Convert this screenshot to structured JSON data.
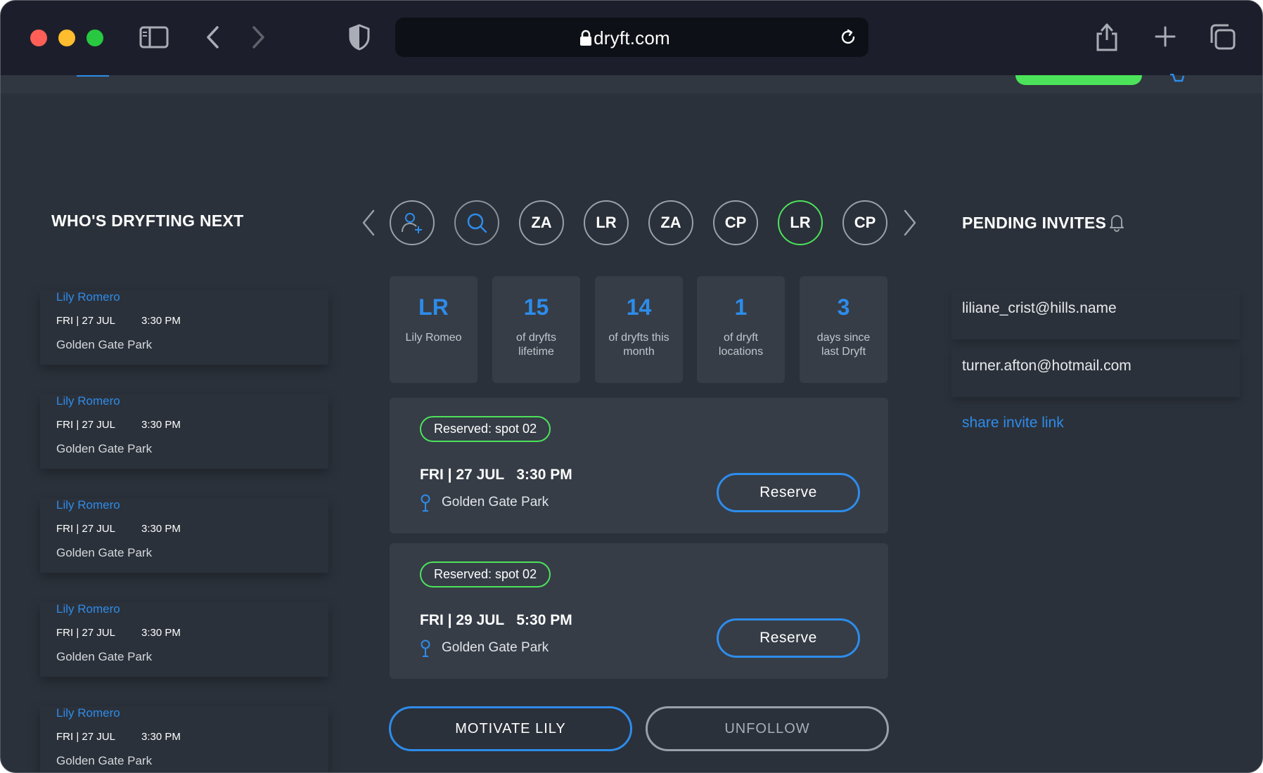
{
  "browser": {
    "url": "dryft.com"
  },
  "colors": {
    "accent_blue": "#2d8ceb",
    "accent_green": "#4ce35a",
    "background": "#2b313a",
    "card": "#363d47"
  },
  "left_panel": {
    "title": "WHO'S DRYFTING NEXT",
    "items": [
      {
        "name": "Lily Romero",
        "date": "FRI | 27 JUL",
        "time": "3:30 PM",
        "location": "Golden Gate Park"
      },
      {
        "name": "Lily Romero",
        "date": "FRI | 27 JUL",
        "time": "3:30 PM",
        "location": "Golden Gate Park"
      },
      {
        "name": "Lily Romero",
        "date": "FRI | 27 JUL",
        "time": "3:30 PM",
        "location": "Golden Gate Park"
      },
      {
        "name": "Lily Romero",
        "date": "FRI | 27 JUL",
        "time": "3:30 PM",
        "location": "Golden Gate Park"
      },
      {
        "name": "Lily Romero",
        "date": "FRI | 27 JUL",
        "time": "3:30 PM",
        "location": "Golden Gate Park"
      }
    ]
  },
  "carousel": {
    "avatars": [
      "ZA",
      "LR",
      "ZA",
      "CP",
      "LR",
      "CP"
    ]
  },
  "stats": [
    {
      "value": "LR",
      "label": "Lily Romeo"
    },
    {
      "value": "15",
      "label": "of dryfts lifetime"
    },
    {
      "value": "14",
      "label": "of dryfts this month"
    },
    {
      "value": "1",
      "label": "of dryft locations"
    },
    {
      "value": "3",
      "label": "days since last Dryft"
    }
  ],
  "sessions": [
    {
      "badge": "Reserved: spot 02",
      "datetime": "FRI | 27 JUL   3:30 PM",
      "location": "Golden Gate Park",
      "button": "Reserve"
    },
    {
      "badge": "Reserved: spot 02",
      "datetime": "FRI | 29 JUL   5:30 PM",
      "location": "Golden Gate Park",
      "button": "Reserve"
    }
  ],
  "actions": {
    "motivate": "MOTIVATE LILY",
    "unfollow": "UNFOLLOW"
  },
  "invites": {
    "title": "PENDING INVITES",
    "emails": [
      "liliane_crist@hills.name",
      "turner.afton@hotmail.com"
    ],
    "share_link": "share invite link"
  }
}
